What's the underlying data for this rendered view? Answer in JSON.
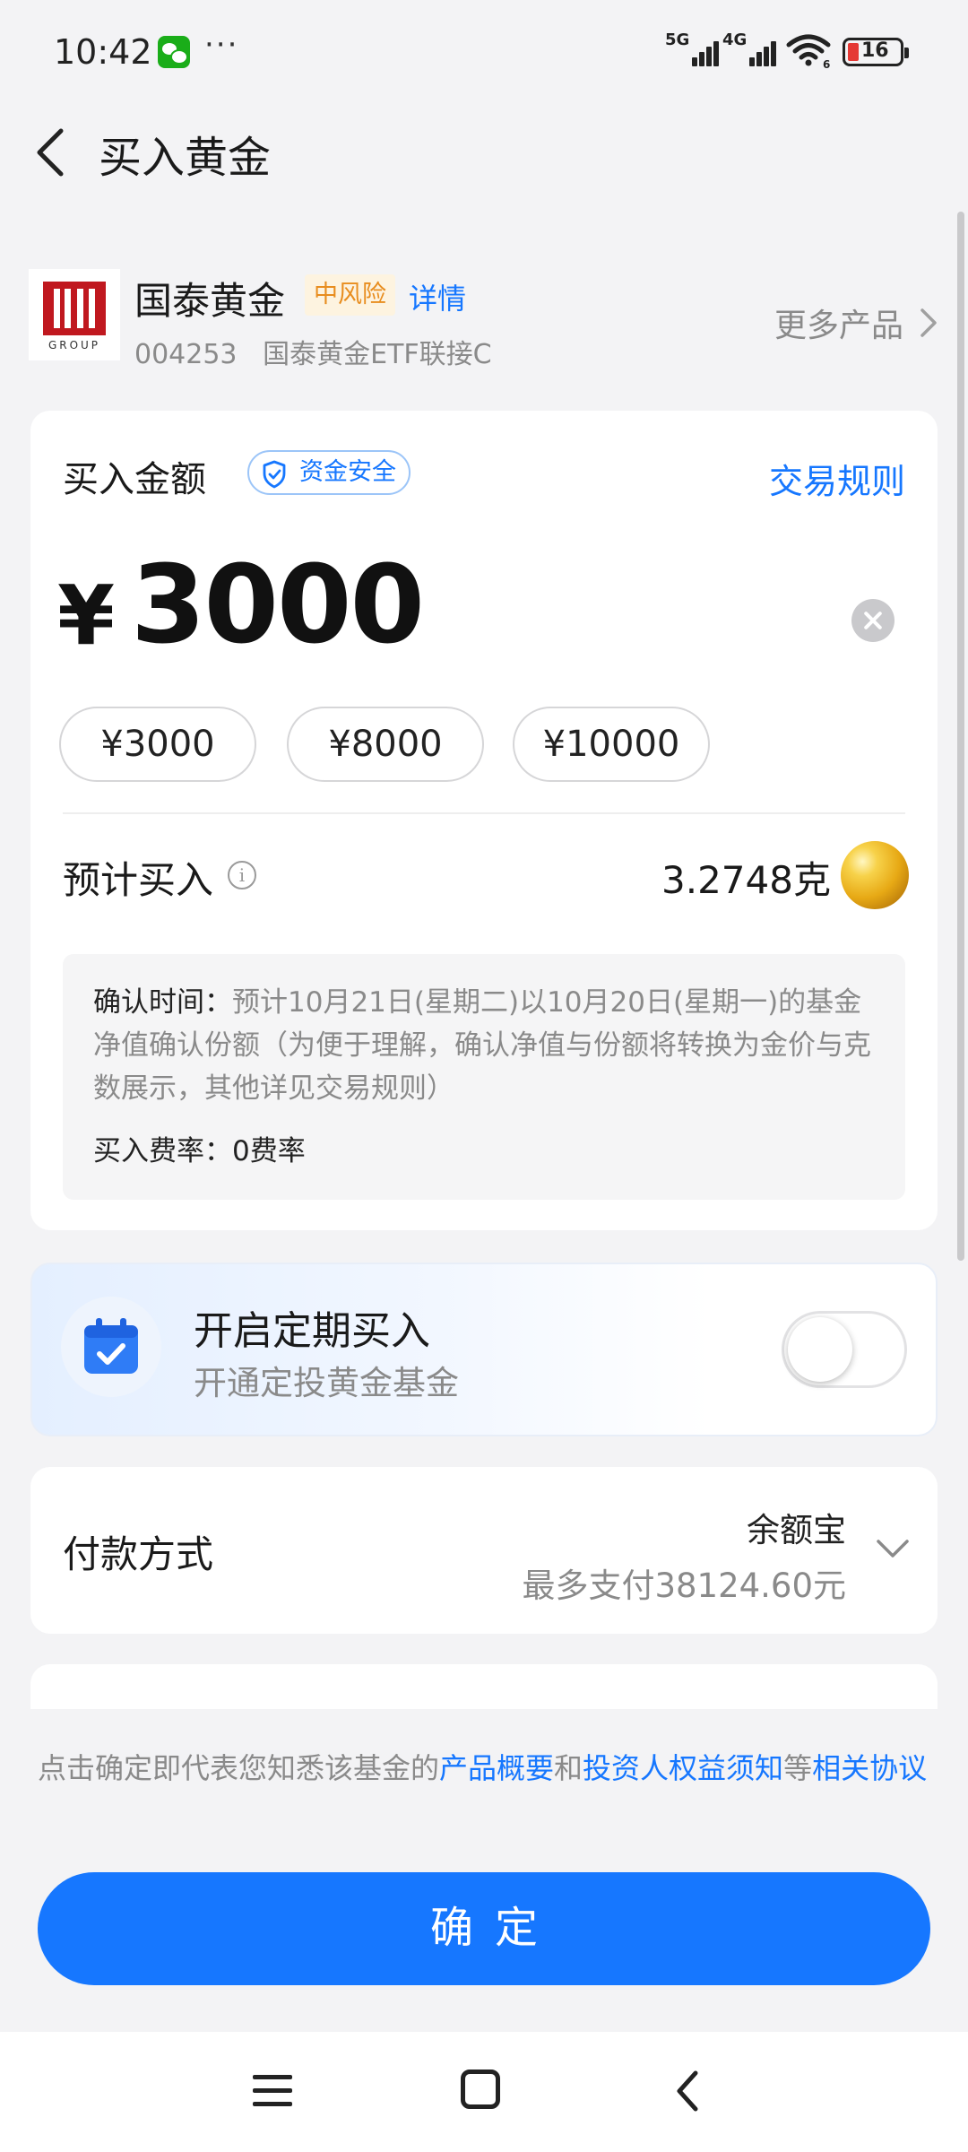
{
  "status_bar": {
    "time": "10:42",
    "more": "···",
    "network1": "5G",
    "network2": "4G",
    "wifi_sub": "6",
    "battery": "16"
  },
  "header": {
    "title": "买入黄金"
  },
  "product": {
    "logo_text": "GROUP",
    "name": "国泰黄金",
    "risk": "中风险",
    "detail": "详情",
    "code": "004253",
    "full_name": "国泰黄金ETF联接C",
    "more": "更多产品"
  },
  "purchase": {
    "label": "买入金额",
    "safety_badge": "资金安全",
    "rules_link": "交易规则",
    "currency": "¥",
    "amount": "3000",
    "quick_amounts": [
      "¥3000",
      "¥8000",
      "¥10000"
    ],
    "estimate_label": "预计买入",
    "estimate_value": "3.2748克",
    "notice_label": "确认时间：",
    "notice_text": "预计10月21日(星期二)以10月20日(星期一)的基金净值确认份额（为便于理解，确认净值与份额将转换为金价与克数展示，其他详见交易规则）",
    "fee_label": "买入费率：",
    "fee_value": "0费率"
  },
  "auto_invest": {
    "title": "开启定期买入",
    "subtitle": "开通定投黄金基金",
    "enabled": false
  },
  "payment": {
    "label": "付款方式",
    "method": "余额宝",
    "limit": "最多支付38124.60元"
  },
  "agreement": {
    "prefix": "点击确定即代表您知悉该基金的",
    "link1": "产品概要",
    "and": "和",
    "link2": "投资人权益须知",
    "etc": "等",
    "link3": "相关协议"
  },
  "confirm_button": "确定",
  "colors": {
    "accent": "#1677ff",
    "risk": "#e88d1f",
    "background": "#f3f3f5"
  },
  "icons": [
    "back-arrow-icon",
    "shield-check-icon",
    "clear-icon",
    "info-icon",
    "gold-ball-icon",
    "calendar-check-icon",
    "chevron-down-icon",
    "chevron-right-icon"
  ]
}
